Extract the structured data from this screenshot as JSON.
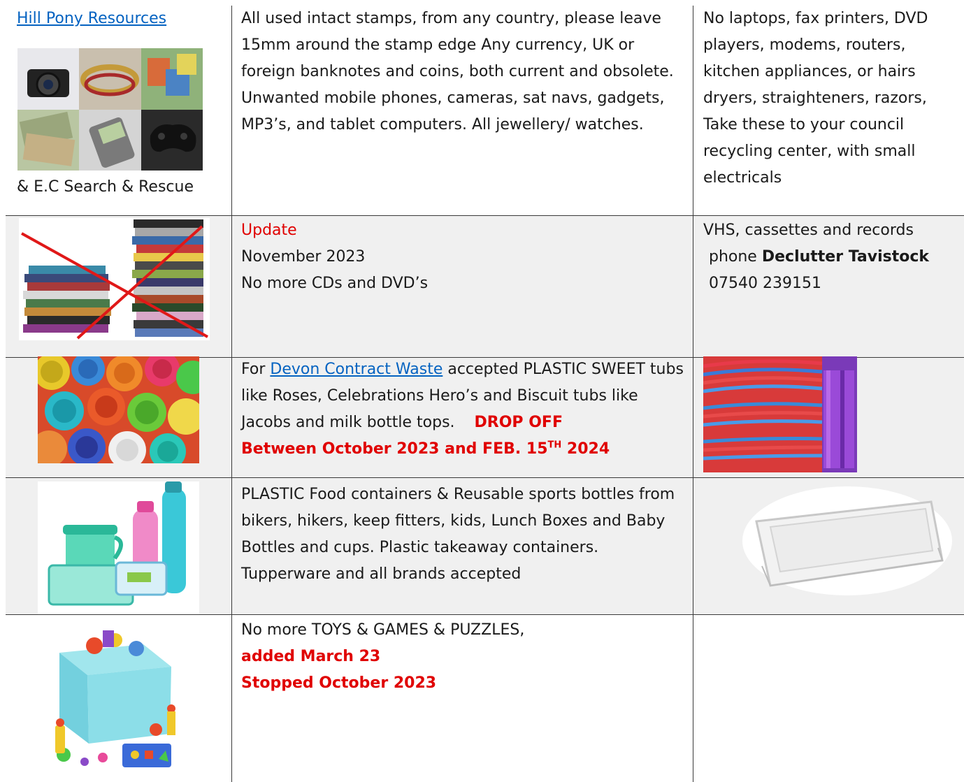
{
  "row1": {
    "col1_link": "Hill Pony Resources",
    "col1_caption": "& E.C Search & Rescue",
    "col2_text": "All used intact stamps, from any country, please leave 15mm around the stamp edge Any currency, UK or foreign banknotes and coins, both current and obsolete. Unwanted mobile phones, cameras, sat navs, gadgets, MP3’s, and tablet computers. All jewellery/ watches.",
    "col3_text": "No laptops, fax printers, DVD players, modems, routers, kitchen appliances, or hairs dryers, straighteners, razors, Take these to your council recycling center, with small electricals"
  },
  "row2": {
    "update_label": "Update",
    "date": "November 2023",
    "notice": "No more CDs and DVD’s",
    "col3_line1": "VHS, cassettes and records",
    "col3_phone_prefix": "phone ",
    "col3_org": "Declutter Tavistock",
    "col3_number": "07540 239151"
  },
  "row3": {
    "prefix": "For ",
    "link": "Devon Contract Waste",
    "text": " accepted  PLASTIC SWEET tubs like Roses, Celebrations Hero’s and Biscuit tubs like Jacobs and milk bottle tops.",
    "drop_off": "DROP OFF",
    "between": "Between October 2023 and FEB. 15",
    "sup": "TH",
    "year": " 2024"
  },
  "row4": {
    "text": "PLASTIC Food containers & Reusable sports bottles from bikers, hikers, keep fitters, kids, Lunch Boxes and Baby Bottles and cups. Plastic takeaway containers. Tupperware and all brands accepted"
  },
  "row5": {
    "line1": "No more TOYS & GAMES & PUZZLES,",
    "line2": "added March 23",
    "line3": "Stopped October 2023"
  },
  "colors": {
    "link": "#0563c1",
    "red": "#e00000",
    "shade": "#f0f0f0",
    "border": "#3a3a3a"
  },
  "icons": [
    "collectables-collage",
    "crossed-out-dvds",
    "bottle-tops",
    "colourful-tubs",
    "food-containers",
    "plastic-takeaway-container",
    "toy-box"
  ]
}
